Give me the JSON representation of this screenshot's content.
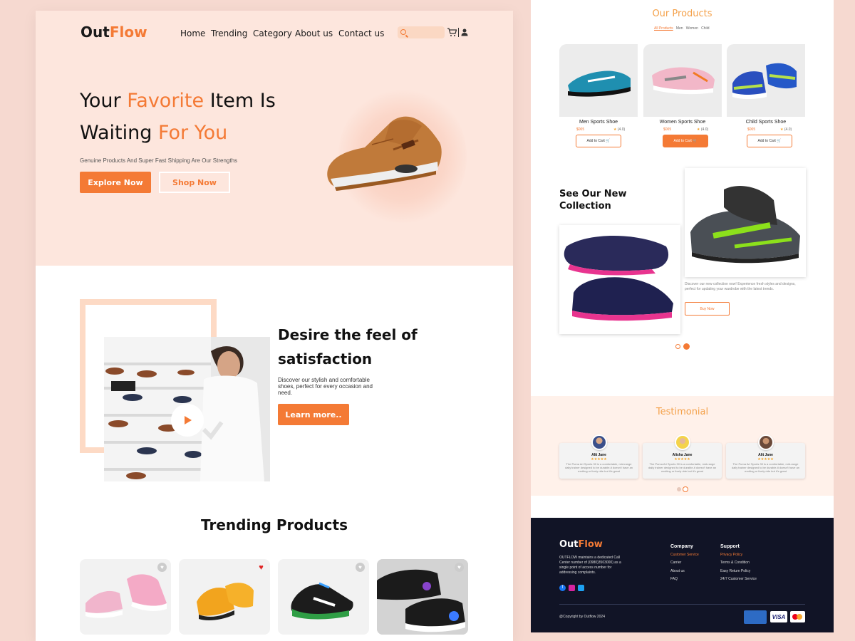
{
  "brand": {
    "name_a": "Out",
    "name_b": "Flow"
  },
  "nav": {
    "items": [
      "Home",
      "Trending",
      "Category",
      "About us",
      "Contact us"
    ]
  },
  "hero": {
    "line1_a": "Your ",
    "line1_b": "Favorite",
    "line1_c": " Item Is",
    "line2_a": "Waiting ",
    "line2_b": "For You",
    "subtitle": "Genuine Products And Super Fast Shipping Are Our Strengths",
    "primary_btn": "Explore Now",
    "secondary_btn": "Shop Now"
  },
  "about": {
    "title_line1": "Desire the feel of",
    "title_line2": "satisfaction",
    "text": "Discover our stylish and comfortable shoes, perfect for every occasion and need.",
    "button": "Learn  more.."
  },
  "trending": {
    "title": "Trending Products"
  },
  "products": {
    "title": "Our Products",
    "filters": [
      "All Products",
      "Men",
      "Women",
      "Child"
    ],
    "items": [
      {
        "name": "Men Sports Shoe",
        "price": "$005",
        "rating": "(4.0)",
        "button": "Add to Cart"
      },
      {
        "name": "Women Sports Shoe",
        "price": "$005",
        "rating": "(4.0)",
        "button": "Add to Cart"
      },
      {
        "name": "Child Sports Shoe",
        "price": "$005",
        "rating": "(4.0)",
        "button": "Add to Cart"
      }
    ]
  },
  "collection": {
    "title_line1": "See Our New",
    "title_line2": "Collection",
    "text": "Discover our new collection now! Experience fresh styles and designs, perfect for updating your wardrobe with the latest trends.",
    "button": "Buy Now"
  },
  "testimonial": {
    "title": "Testimonial",
    "items": [
      {
        "name": "Alit Jane",
        "stars": "★★★★★",
        "text": "The Puma Ari Sports 30 is a comfortable, mid-range daily trainer designed to be durable-it doesn't have an exciting or lively ride but it's great"
      },
      {
        "name": "Alisha Jane",
        "stars": "★★★★★",
        "text": "The Puma Ari Sports 30 is a comfortable, mid-range daily trainer designed to be durable-it doesn't have an exciting or lively ride but it's great"
      },
      {
        "name": "Alit Jane",
        "stars": "★★★★★",
        "text": "The Puma Ari Sports 30 is a comfortable, mid-range daily trainer designed to be durable-it doesn't have an exciting or lively ride but it's great"
      }
    ]
  },
  "footer": {
    "logo_a": "Out",
    "logo_b": "Flow",
    "desc": "OUTFLOW maintains a dedicated Call Center number of (0980)3503000) as a single point of access number for addressing complaints.",
    "company_title": "Company",
    "company_links": [
      "Customer Service",
      "Carrier",
      "About us",
      "FAQ"
    ],
    "support_title": "Support",
    "support_links": [
      "Privacy Policy",
      "Terms & Condition",
      "Easy Return Policy",
      "24/7 Customer Service"
    ],
    "copyright": "@Copyright by Outflow 2024",
    "visa": "VISA"
  },
  "colors": {
    "accent": "#f47a35",
    "hero_bg": "#fde6dd",
    "page_bg": "#f6d9d0",
    "footer_bg": "#111426"
  },
  "icons": [
    "search-icon",
    "cart-icon",
    "user-icon",
    "play-icon",
    "heart-icon",
    "star-icon",
    "facebook-icon",
    "instagram-icon",
    "twitter-icon"
  ]
}
